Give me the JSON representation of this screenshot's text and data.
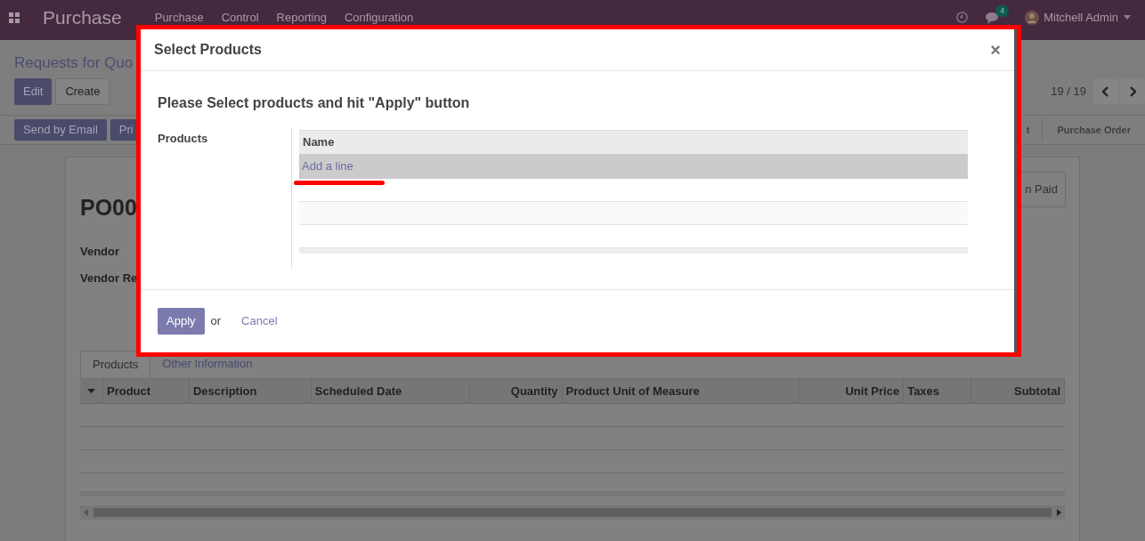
{
  "navbar": {
    "app_title": "Purchase",
    "menu": [
      "Purchase",
      "Control",
      "Reporting",
      "Configuration"
    ],
    "message_count": "4",
    "user": "Mitchell Admin"
  },
  "control_panel": {
    "breadcrumb": "Requests for Quo",
    "buttons": [
      "Edit",
      "Create"
    ],
    "pager": "19 / 19",
    "actions": [
      "Send by Email",
      "Pri"
    ],
    "stages": [
      "t",
      "Purchase Order"
    ]
  },
  "sheet": {
    "title": "PO00",
    "smart_button": "n Paid",
    "fields": [
      "Vendor",
      "Vendor Re"
    ],
    "tabs": [
      {
        "label": "Products",
        "selected": true
      },
      {
        "label": "Other Information",
        "selected": false
      }
    ],
    "columns": [
      "Product",
      "Description",
      "Scheduled Date",
      "Quantity",
      "Product Unit of Measure",
      "Unit Price",
      "Taxes",
      "Subtotal"
    ]
  },
  "dialog": {
    "title": "Select Products",
    "close": "×",
    "heading": "Please Select products and hit \"Apply\" button",
    "field_label": "Products",
    "column": "Name",
    "add_line": "Add a line",
    "apply": "Apply",
    "or": "or",
    "cancel": "Cancel"
  }
}
